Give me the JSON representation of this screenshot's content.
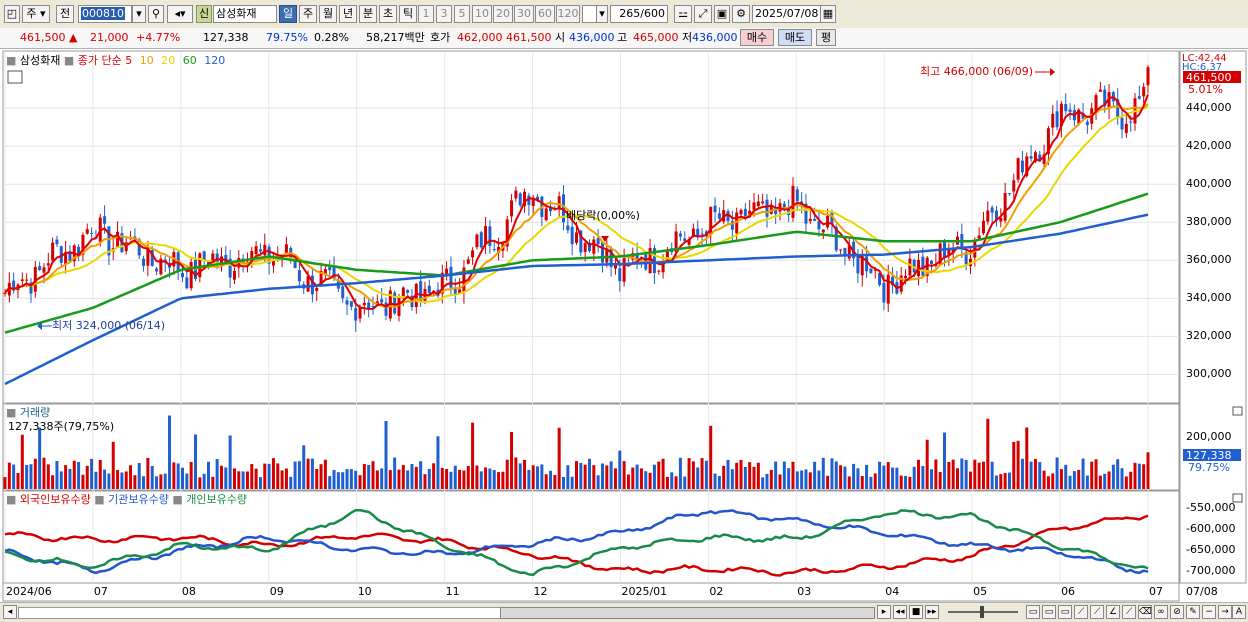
{
  "toolbar": {
    "period_selector": "주",
    "prev_label": "전",
    "stock_code": "000810",
    "new_badge": "신",
    "stock_name": "삼성화재",
    "period_tabs": [
      "일",
      "주",
      "월",
      "년",
      "분",
      "초",
      "틱"
    ],
    "active_period": "일",
    "intervals": [
      "1",
      "3",
      "5",
      "10",
      "20",
      "30",
      "60",
      "120"
    ],
    "count_value": "265",
    "count_max": "/600",
    "date_value": "2025/07/08"
  },
  "infobar": {
    "price": "461,500",
    "change": "21,000",
    "change_pct": "+4.77%",
    "volume": "127,338",
    "vol_ratio": "79.75%",
    "turnover_pct": "0.28%",
    "amount": "58,217백만",
    "quote_label": "호가",
    "ask": "462,000",
    "bid": "461,500",
    "open_label": "시",
    "open": "436,000",
    "high_label": "고",
    "high": "465,000",
    "low_label": "저",
    "low": "436,000",
    "buy_label": "매수",
    "sell_label": "매도",
    "eval_label": "평"
  },
  "price_panel": {
    "legend_name": "삼성화재",
    "legend_ma": "종가 단순",
    "ma_labels": [
      {
        "label": "5",
        "color": "#e00000"
      },
      {
        "label": "10",
        "color": "#f0a000"
      },
      {
        "label": "20",
        "color": "#e8d800"
      },
      {
        "label": "60",
        "color": "#1a9a1a"
      },
      {
        "label": "120",
        "color": "#1f5fd0"
      }
    ],
    "high_annotation": "최고 466,000 (06/09)",
    "low_annotation": "최저 324,000 (06/14)",
    "dividend_annotation": "배당락(0,00%)",
    "lc_label": "LC:42,44",
    "hc_label": "HC:6,37",
    "current_price_tag": "461,500",
    "current_pct_tag": "5.01%",
    "y_ticks": [
      "440,000",
      "420,000",
      "400,000",
      "380,000",
      "360,000",
      "340,000",
      "320,000",
      "300,000"
    ]
  },
  "volume_panel": {
    "title": "거래량",
    "value_label": "127,338주(79,75%)",
    "y_ticks": [
      "200,000",
      "100,000"
    ],
    "current_tag": "127,338",
    "current_pct": "79.75%"
  },
  "holdings_panel": {
    "series": [
      {
        "name": "외국인보유수량",
        "color": "#d40000"
      },
      {
        "name": "기관보유수량",
        "color": "#2255cc"
      },
      {
        "name": "개인보유수량",
        "color": "#1a8a4a"
      }
    ],
    "y_ticks": [
      "-550,000",
      "-600,000",
      "-650,000",
      "-700,000"
    ]
  },
  "x_axis": {
    "labels": [
      "2024/06",
      "07",
      "08",
      "09",
      "10",
      "11",
      "12",
      "2025/01",
      "02",
      "03",
      "04",
      "05",
      "06",
      "07"
    ],
    "right_label": "07/08"
  },
  "colors": {
    "up": "#d40000",
    "down": "#1f5fd0",
    "ma5": "#e00000",
    "ma10": "#f0a000",
    "ma20": "#e8d800",
    "ma60": "#1a9a1a",
    "ma120": "#1f5fd0"
  },
  "chart_data": {
    "type": "line",
    "title": "",
    "x": [
      "2024/06",
      "07",
      "08",
      "09",
      "10",
      "11",
      "12",
      "2025/01",
      "02",
      "03",
      "04",
      "05",
      "06",
      "07"
    ],
    "series": [
      {
        "name": "5",
        "values": [
          343000,
          376000,
          355000,
          365000,
          335000,
          345000,
          398000,
          355000,
          378000,
          388000,
          348000,
          370000,
          438000,
          440000
        ]
      },
      {
        "name": "60",
        "values": [
          322000,
          335000,
          355000,
          362000,
          355000,
          352000,
          360000,
          362000,
          368000,
          375000,
          370000,
          370000,
          380000,
          395000
        ]
      },
      {
        "name": "120",
        "values": [
          295000,
          318000,
          340000,
          345000,
          348000,
          352000,
          357000,
          358000,
          360000,
          362000,
          363000,
          367000,
          374000,
          384000
        ]
      }
    ],
    "ylim": [
      285000,
      470000
    ],
    "high": 466000,
    "low": 324000,
    "last": 461500
  }
}
